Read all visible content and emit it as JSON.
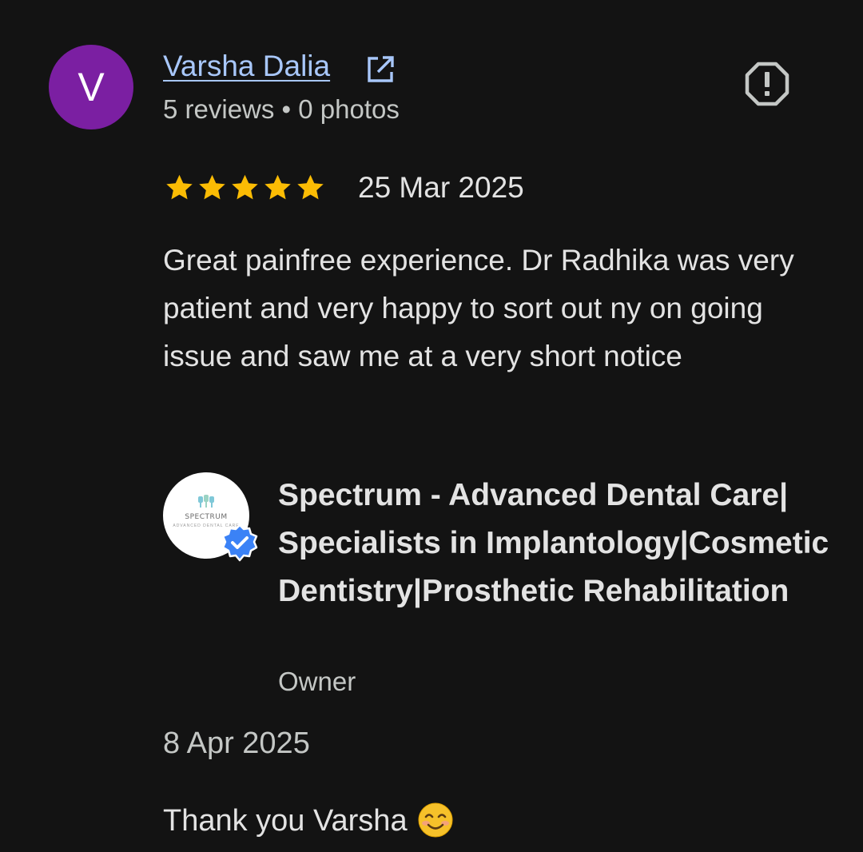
{
  "review": {
    "avatar_letter": "V",
    "reviewer_name": "Varsha Dalia",
    "reviewer_meta": "5 reviews • 0 photos",
    "rating": 5,
    "rating_max": 5,
    "date": "25 Mar 2025",
    "text": "Great painfree experience. Dr Radhika was very patient and very happy to sort out ny on going issue and saw me at a very short notice"
  },
  "owner_reply": {
    "logo_text": "SPECTRUM",
    "logo_subtext": "ADVANCED DENTAL CARE",
    "business_name": "Spectrum - Advanced Dental Care| Specialists in Implantology|Cosmetic Dentistry|Prosthetic Rehabilitation",
    "role": "Owner",
    "date": "8 Apr 2025",
    "text": "Thank you Varsha"
  },
  "colors": {
    "background": "#131313",
    "avatar": "#7b1fa2",
    "link": "#a8c7fa",
    "star": "#fbbc04",
    "verified": "#3b82f6"
  },
  "icons": {
    "external_link": "external-link-icon",
    "report": "report-icon",
    "star": "star-icon",
    "verified": "verified-badge-icon",
    "emoji": "smiling-face-emoji-icon"
  }
}
